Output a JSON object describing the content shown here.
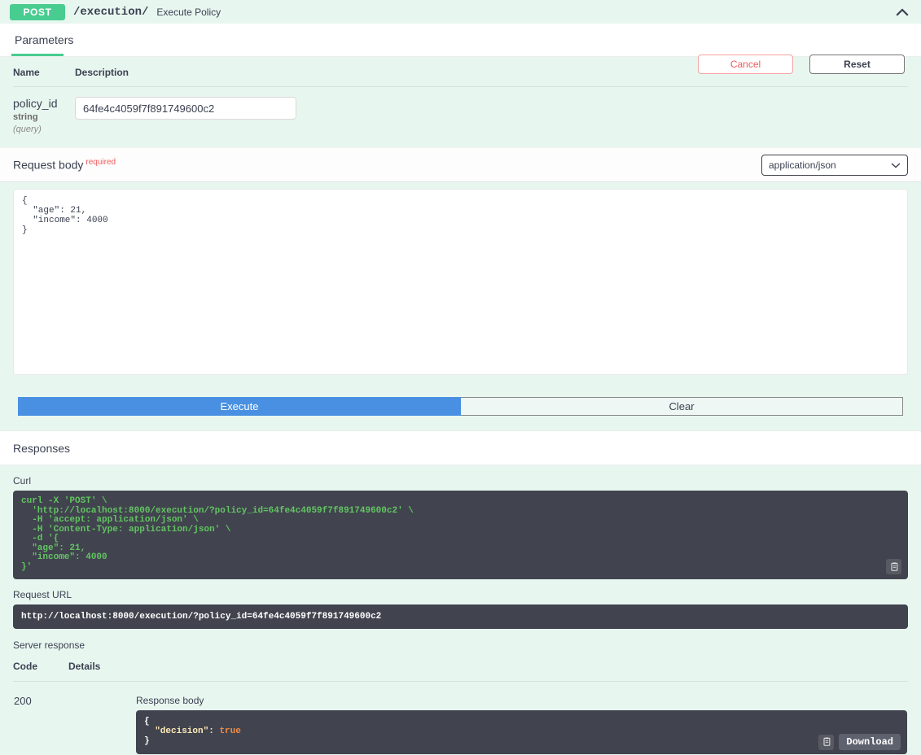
{
  "operation": {
    "method": "POST",
    "path": "/execution/",
    "summary": "Execute Policy",
    "collapse_icon": "chevron-up-icon"
  },
  "tabs": [
    {
      "label": "Parameters",
      "active": true
    }
  ],
  "header_buttons": {
    "cancel_label": "Cancel",
    "reset_label": "Reset"
  },
  "parameters": {
    "columns": [
      "Name",
      "Description"
    ],
    "rows": [
      {
        "name": "policy_id",
        "type": "string",
        "in": "(query)",
        "value": "64fe4c4059f7f891749600c2",
        "placeholder": "policy_id"
      }
    ]
  },
  "request_body": {
    "label": "Request body",
    "required_tag": "required",
    "content_type": "application/json",
    "content_type_options": [
      "application/json"
    ],
    "dropdown_icon": "chevron-down-icon",
    "editor_value": "{\n  \"age\": 21,\n  \"income\": 4000\n}",
    "resize_handle_icon": "resize-grip-icon"
  },
  "actions": {
    "execute_label": "Execute",
    "clear_label": "Clear",
    "execute_color": "#4990e2"
  },
  "responses": {
    "section_title": "Responses",
    "curl_label": "Curl",
    "curl_command": "curl -X 'POST' \\\n  'http://localhost:8000/execution/?policy_id=64fe4c4059f7f891749600c2' \\\n  -H 'accept: application/json' \\\n  -H 'Content-Type: application/json' \\\n  -d '{\n  \"age\": 21,\n  \"income\": 4000\n}'",
    "curl_copy_icon": "copy-to-clipboard-icon",
    "request_url_label": "Request URL",
    "request_url": "http://localhost:8000/execution/?policy_id=64fe4c4059f7f891749600c2",
    "server_response_label": "Server response",
    "columns": [
      "Code",
      "Details"
    ],
    "rows": [
      {
        "code": "200",
        "response_body_label": "Response body",
        "body_open": "{",
        "body_key": "\"decision\":",
        "body_value": "true",
        "body_close": "}",
        "copy_icon": "copy-to-clipboard-icon",
        "download_label": "Download"
      }
    ]
  },
  "colors": {
    "method_post": "#49cc90",
    "accent_green": "#49cc90",
    "execute_blue": "#4990e2",
    "cancel_red": "#f05a5a",
    "panel_bg": "#e8f6f0",
    "code_bg": "#41444e",
    "code_green": "#62c462"
  }
}
